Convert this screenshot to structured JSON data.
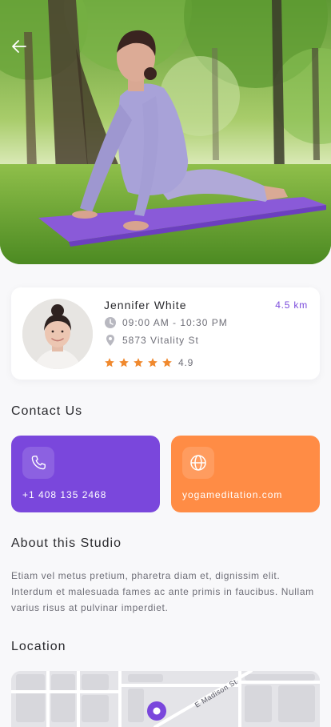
{
  "hero": {
    "back_icon": "arrow-left-icon"
  },
  "profile": {
    "name": "Jennifer White",
    "distance": "4.5 km",
    "hours": "09:00 AM - 10:30 PM",
    "address": "5873 Vitality St",
    "rating": 4.9,
    "rating_label": "4.9",
    "stars": 5,
    "star_color": "#f0892e",
    "hours_icon": "clock-icon",
    "address_icon": "map-pin-icon"
  },
  "contact": {
    "title": "Contact Us",
    "phone": "+1 408 135 2468",
    "phone_icon": "phone-icon",
    "phone_color": "#7a47dc",
    "website": "yogameditation.com",
    "website_icon": "globe-icon",
    "website_color": "#ff8c45"
  },
  "about": {
    "title": "About this Studio",
    "text": "Etiam vel metus pretium, pharetra diam et, dignissim elit. Interdum et malesuada fames ac ante primis in faucibus. Nullam varius risus at pulvinar imperdiet."
  },
  "location": {
    "title": "Location",
    "street_label": "E Madison St",
    "marker_color": "#7a47dc"
  }
}
